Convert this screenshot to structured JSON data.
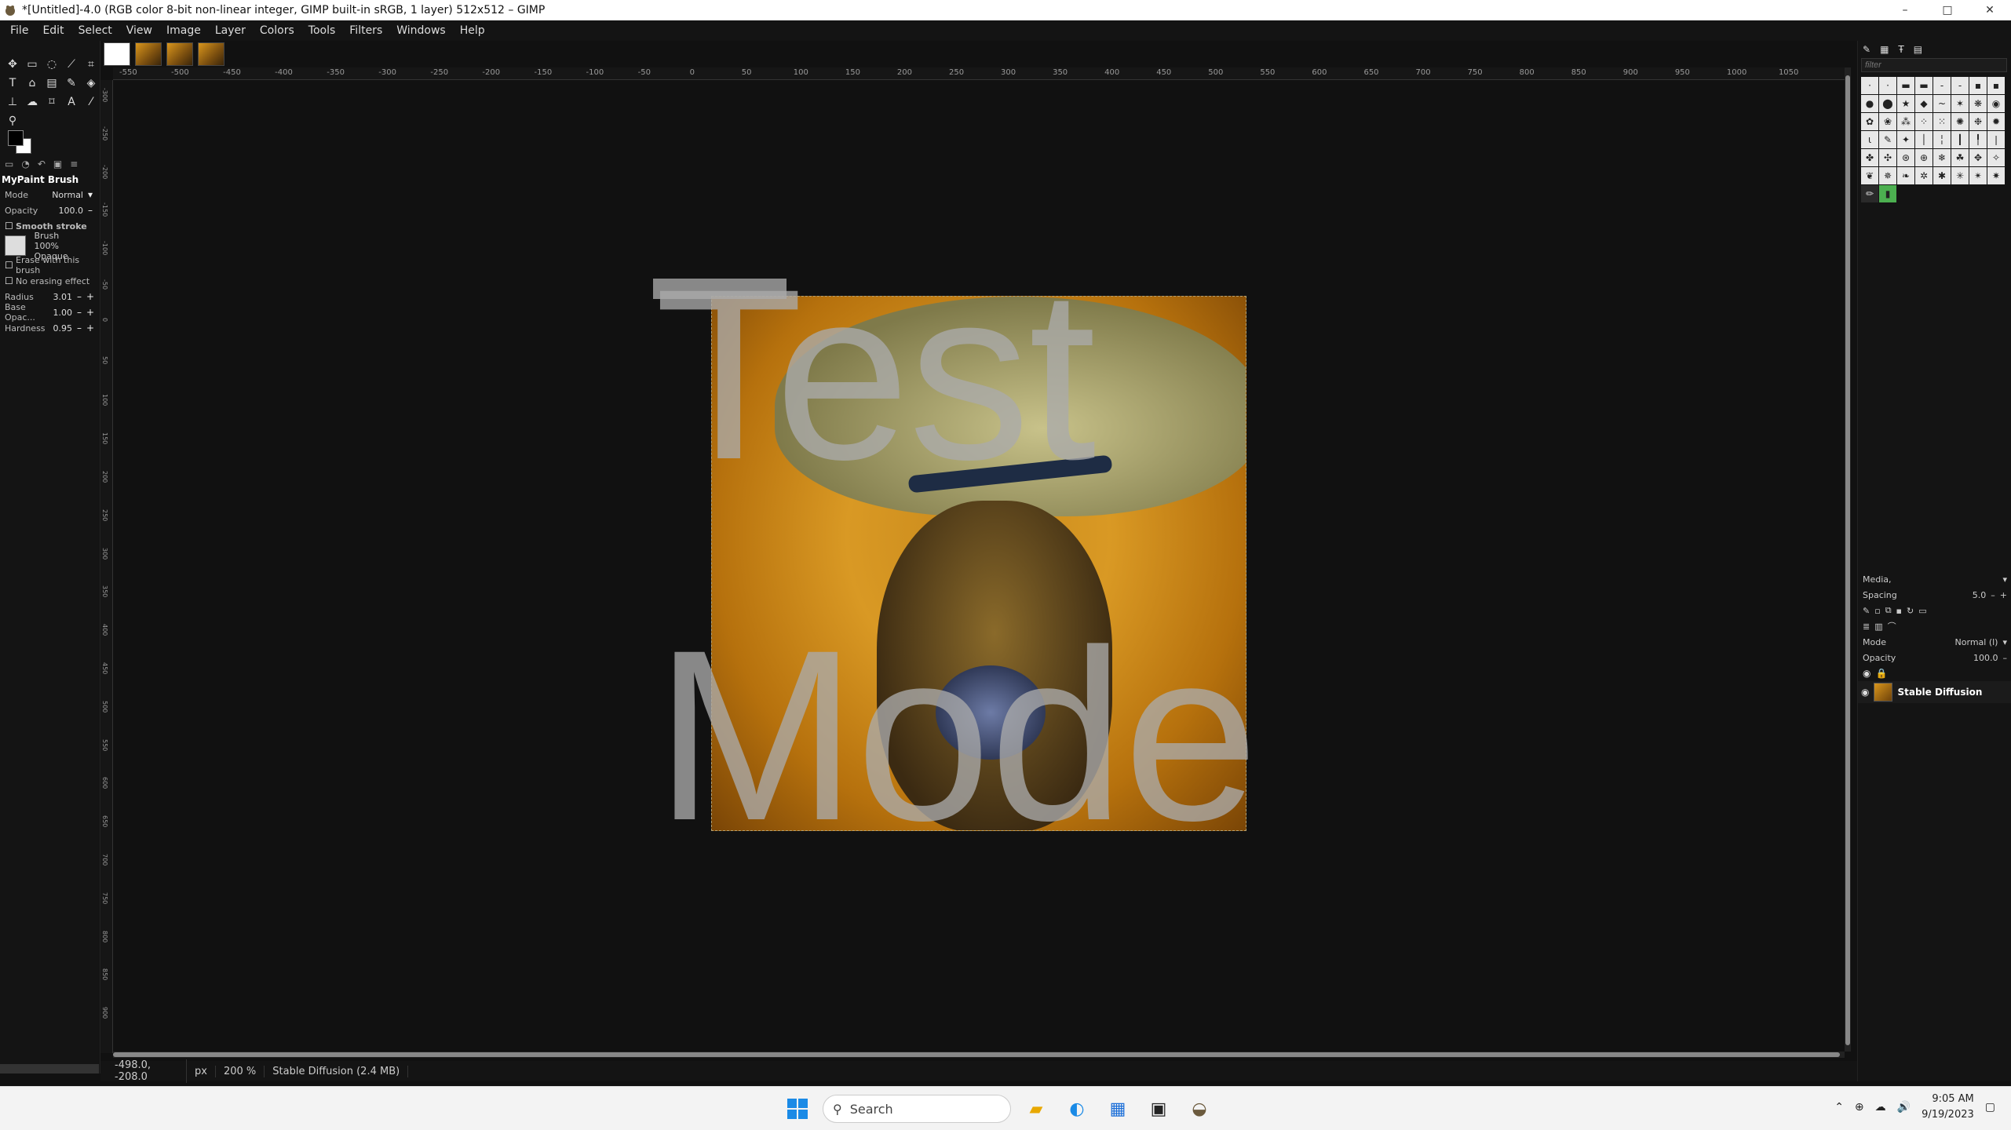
{
  "window": {
    "title": "*[Untitled]-4.0 (RGB color 8-bit non-linear integer, GIMP built-in sRGB, 1 layer) 512x512 – GIMP",
    "minimize": "–",
    "maximize": "□",
    "close": "✕"
  },
  "menu": [
    "File",
    "Edit",
    "Select",
    "View",
    "Image",
    "Layer",
    "Colors",
    "Tools",
    "Filters",
    "Windows",
    "Help"
  ],
  "tool_options": {
    "title": "MyPaint Brush",
    "mode_label": "Mode",
    "mode_value": "Normal",
    "opacity_label": "Opacity",
    "opacity_value": "100.0",
    "smooth_stroke": "Smooth stroke",
    "brush_label": "Brush",
    "brush_name": "100% Opaque",
    "erase_label": "Erase with this brush",
    "no_erase_label": "No erasing effect",
    "radius_label": "Radius",
    "radius_value": "3.01",
    "base_opacity_label": "Base Opac...",
    "base_opacity_value": "1.00",
    "hardness_label": "Hardness",
    "hardness_value": "0.95"
  },
  "ruler_top": [
    "-550",
    "-500",
    "-450",
    "-400",
    "-350",
    "-300",
    "-250",
    "-200",
    "-150",
    "-100",
    "-50",
    "0",
    "50",
    "100",
    "150",
    "200",
    "250",
    "300",
    "350",
    "400",
    "450",
    "500",
    "550",
    "600",
    "650",
    "700",
    "750",
    "800",
    "850",
    "900",
    "950",
    "1000",
    "1050"
  ],
  "ruler_left": [
    "-300",
    "-250",
    "-200",
    "-150",
    "-100",
    "-50",
    "0",
    "50",
    "100",
    "150",
    "200",
    "250",
    "300",
    "350",
    "400",
    "450",
    "500",
    "550",
    "600",
    "650",
    "700",
    "750",
    "800",
    "850",
    "900"
  ],
  "canvas": {
    "text_top": "Test",
    "text_bottom": "Mode"
  },
  "status": {
    "coords": "-498.0, -208.0",
    "unit": "px",
    "zoom": "200 %",
    "layer_info": "Stable Diffusion (2.4 MB)"
  },
  "dock": {
    "filter_placeholder": "filter",
    "media_label": "Media,",
    "spacing_label": "Spacing",
    "spacing_value": "5.0",
    "mode_label": "Mode",
    "mode_value": "Normal (l)",
    "opacity_label": "Opacity",
    "opacity_value": "100.0",
    "layer_name": "Stable Diffusion"
  },
  "taskbar": {
    "search_placeholder": "Search",
    "time": "9:05 AM",
    "date": "9/19/2023"
  }
}
